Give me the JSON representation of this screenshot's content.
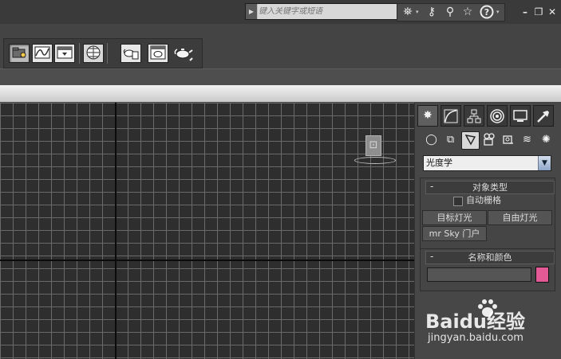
{
  "titlebar": {
    "search_placeholder": "键入关键字或短语",
    "search_icons": [
      "binoculars-icon",
      "key-icon",
      "pin-icon",
      "star-icon",
      "help-icon"
    ],
    "window_controls": [
      "minimize",
      "restore",
      "close"
    ]
  },
  "toolbar": {
    "buttons": [
      "scene-explorer-icon",
      "curve-editor-icon",
      "render-setup-icon",
      "material-editor-icon",
      "rendered-frame-icon",
      "render-icon",
      "render-production-icon"
    ]
  },
  "command_panel": {
    "tabs": [
      "create",
      "modify",
      "hierarchy",
      "motion",
      "display",
      "utilities"
    ],
    "subcategories": [
      "geometry",
      "shapes",
      "lights",
      "cameras",
      "helpers",
      "space-warps",
      "systems"
    ],
    "active_subcategory": "lights",
    "dropdown_value": "光度学",
    "object_type": {
      "title": "对象类型",
      "autogrid_label": "自动栅格",
      "autogrid_checked": false,
      "buttons": [
        "目标灯光",
        "自由灯光",
        "mr Sky 门户"
      ]
    },
    "name_color": {
      "title": "名称和颜色",
      "name_value": "",
      "color": "#e35a96"
    }
  },
  "watermark": {
    "brand": "Baidu经验",
    "url": "jingyan.baidu.com"
  }
}
